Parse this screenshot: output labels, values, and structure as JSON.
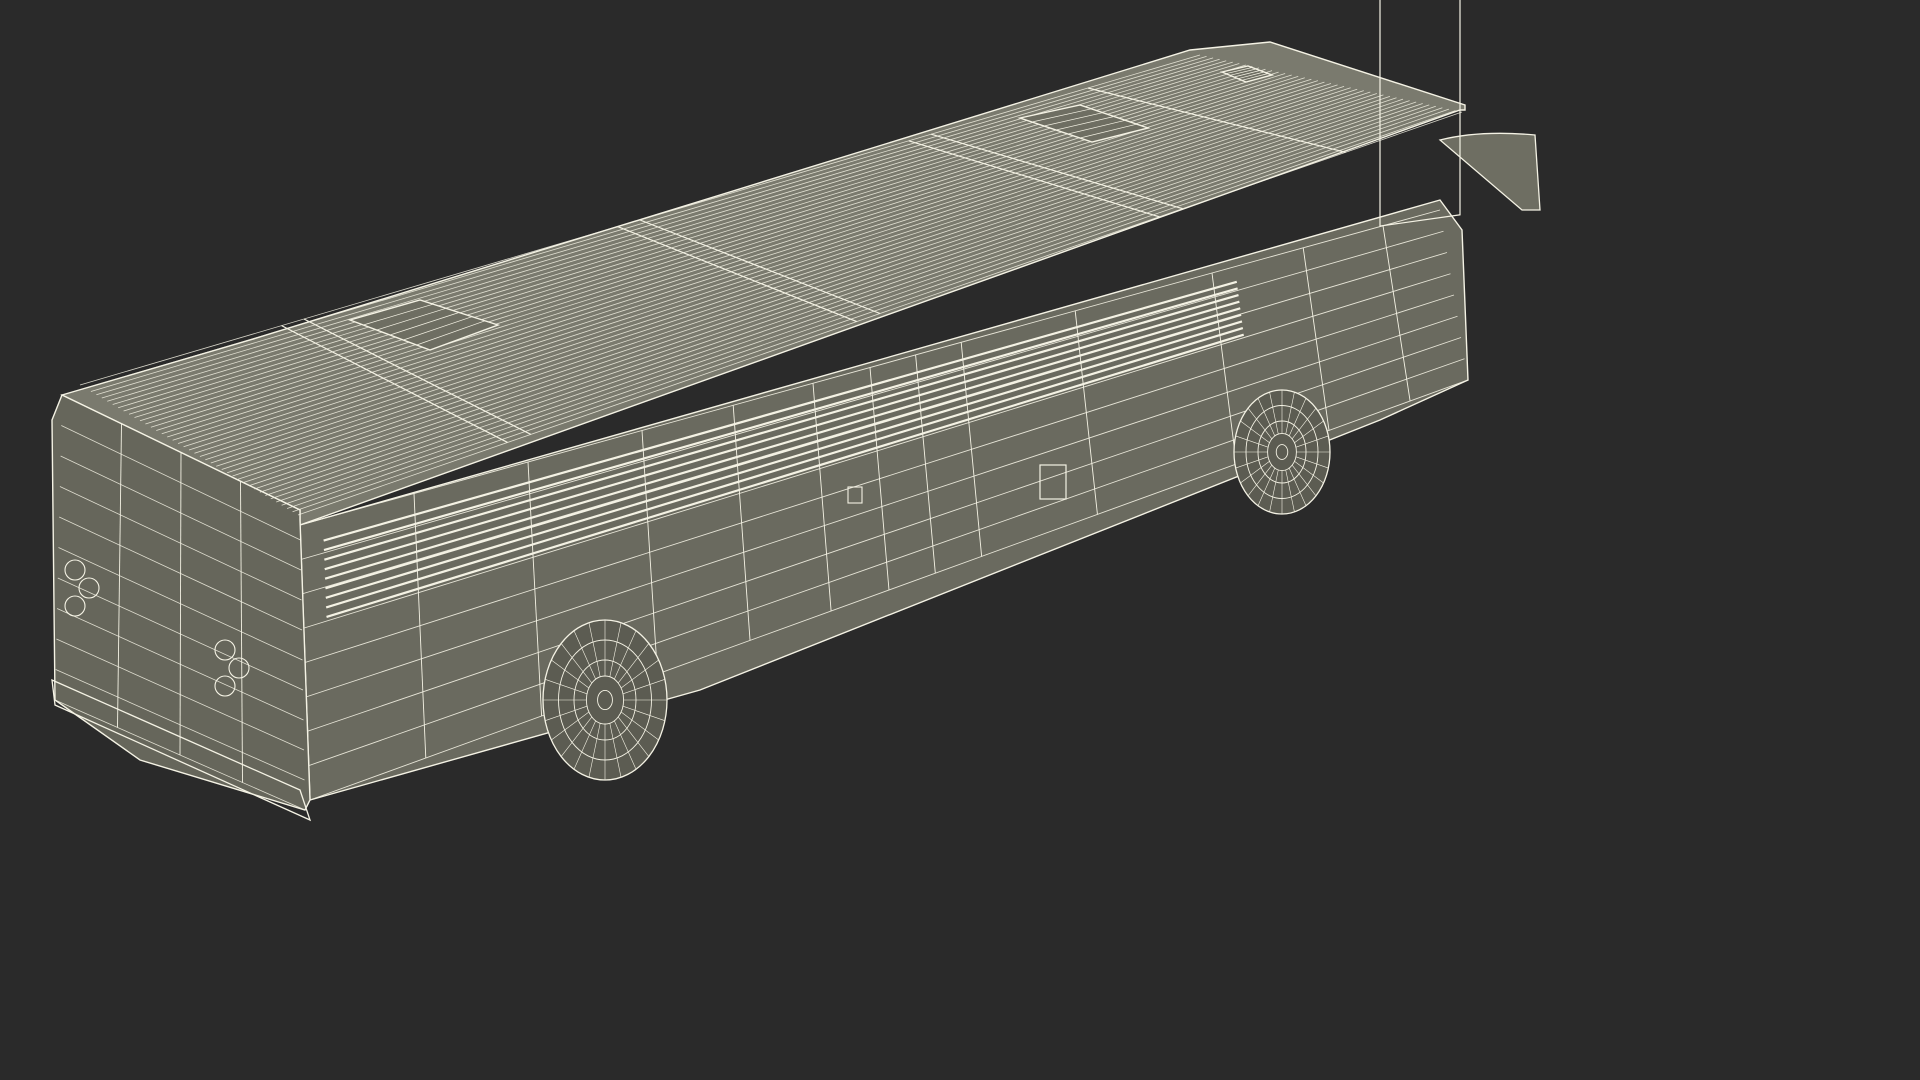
{
  "scene": {
    "subject_icon": "bus-wireframe-icon",
    "background_color": "#2a2a2a",
    "body_fill_color": "#6e6e62",
    "roof_fill_color": "#7a7a6e",
    "side_fill_color": "#6a6a5f",
    "rear_fill_color": "#66665b",
    "wire_color": "#f4f2e4",
    "tire_color": "#5c5c52"
  }
}
